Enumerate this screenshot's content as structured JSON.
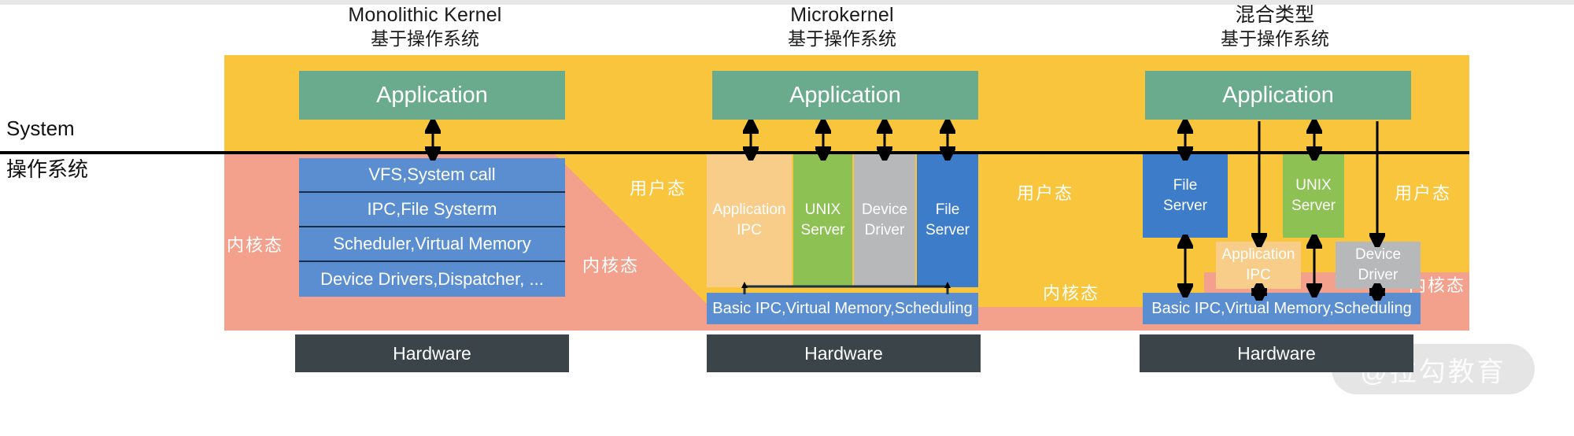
{
  "headings": [
    {
      "en": "Monolithic Kernel",
      "zh": "基于操作系统"
    },
    {
      "en": "Microkernel",
      "zh": "基于操作系统"
    },
    {
      "en": "混合类型",
      "zh": "基于操作系统"
    }
  ],
  "side_labels": {
    "top": "System",
    "bottom": "操作系统"
  },
  "mode_labels": {
    "user": "用户态",
    "kernel": "内核态"
  },
  "common": {
    "application": "Application",
    "hardware": "Hardware",
    "basic_ipc": "Basic IPC,Virtual Memory,Scheduling"
  },
  "monolithic": {
    "rows": [
      "VFS,System call",
      "IPC,File Systerm",
      "Scheduler,Virtual Memory",
      "Device Drivers,Dispatcher, ..."
    ]
  },
  "microkernel": {
    "columns": [
      {
        "line1": "Application",
        "line2": "IPC",
        "color": "#f8cd8a"
      },
      {
        "line1": "UNIX",
        "line2": "Server",
        "color": "#8dc153"
      },
      {
        "line1": "Device",
        "line2": "Driver",
        "color": "#b6b8ba"
      },
      {
        "line1": "File",
        "line2": "Server",
        "color": "#3d7cc9"
      }
    ]
  },
  "hybrid": {
    "user_blocks": [
      {
        "line1": "File",
        "line2": "Server",
        "color": "#3d7cc9"
      },
      {
        "line1": "UNIX",
        "line2": "Server",
        "color": "#8dc153"
      }
    ],
    "kernel_blocks": [
      {
        "line1": "Application",
        "line2": "IPC",
        "color": "#f8cd8a"
      },
      {
        "line1": "Device",
        "line2": "Driver",
        "color": "#b6b8ba"
      }
    ]
  },
  "watermark": "@拉勾教育",
  "colors": {
    "user_band": "#f9c53d",
    "kernel_band": "#f3a18c",
    "application": "#6aab8e",
    "hardware": "#3b4448",
    "kernel_core": "#5b8ed0",
    "divider": "#000000"
  }
}
